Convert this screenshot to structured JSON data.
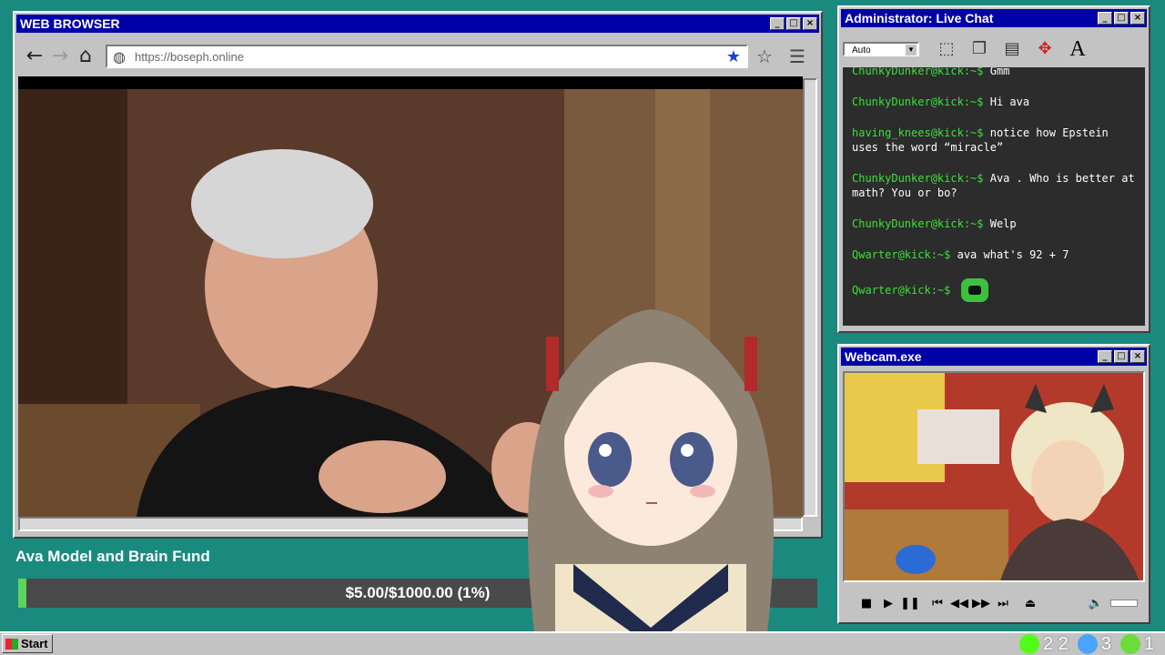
{
  "browser": {
    "title": "WEB BROWSER",
    "url": "https://boseph.online",
    "video_alt": "video"
  },
  "chat": {
    "title": "Administrator: Live Chat",
    "mode": "Auto",
    "messages": [
      {
        "user": "ChunkyDunker@kick:~$",
        "text": " Gmm"
      },
      {
        "user": "ChunkyDunker@kick:~$",
        "text": " Hi ava"
      },
      {
        "user": "having_knees@kick:~$",
        "text": " notice how Epstein uses the word “miracle”"
      },
      {
        "user": "ChunkyDunker@kick:~$",
        "text": " Ava . Who is better at math? You or bo?"
      },
      {
        "user": "ChunkyDunker@kick:~$",
        "text": " Welp"
      },
      {
        "user": "Qwarter@kick:~$",
        "text": " ava what's 92 + 7"
      },
      {
        "user": "Qwarter@kick:~$",
        "text": ""
      }
    ]
  },
  "webcam": {
    "title": "Webcam.exe"
  },
  "fund": {
    "label": "Ava Model and Brain Fund",
    "text": "$5.00/$1000.00 (1%)",
    "progress": 0.01
  },
  "taskbar": {
    "start": "Start",
    "tray": [
      {
        "icon": "kick-icon",
        "value": "2 2",
        "color": "#53fc18"
      },
      {
        "icon": "moon-icon",
        "value": "3",
        "color": "#4aa3ff"
      },
      {
        "icon": "play-icon",
        "value": "1",
        "color": "#6bdc3c"
      }
    ]
  },
  "colors": {
    "desktop": "#1a8a7e",
    "titlebar": "#0000a8",
    "chat_user": "#3be03b"
  }
}
